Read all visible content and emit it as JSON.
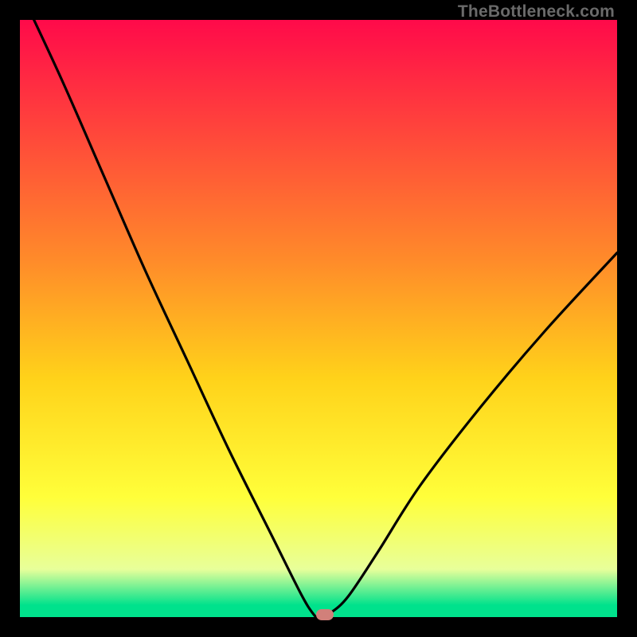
{
  "watermark": "TheBottleneck.com",
  "colors": {
    "frame": "#000000",
    "gradient_top": "#ff0a4a",
    "gradient_bottom": "#00e28c",
    "curve": "#000000",
    "marker": "#d1807a"
  },
  "chart_data": {
    "type": "line",
    "title": "",
    "xlabel": "",
    "ylabel": "",
    "xlim": [
      0,
      100
    ],
    "ylim": [
      0,
      100
    ],
    "grid": false,
    "legend": false,
    "annotations": [
      "TheBottleneck.com"
    ],
    "series": [
      {
        "name": "bottleneck-curve",
        "x": [
          0,
          7,
          14,
          21,
          28,
          35,
          42,
          47,
          49,
          50,
          52,
          55,
          60,
          67,
          77,
          88,
          100
        ],
        "y": [
          105,
          90,
          74,
          58,
          43,
          28,
          14,
          4,
          0.7,
          0,
          0.7,
          3.5,
          11,
          22,
          35,
          48,
          61
        ]
      }
    ],
    "marker": {
      "x": 51,
      "y": 0.4
    },
    "description": "V-shaped curve on rainbow vertical gradient; minimum near x≈50 touching bottom green band; left arm steeper than right; y-axis inverted visually (lower y = bottom of image)."
  }
}
